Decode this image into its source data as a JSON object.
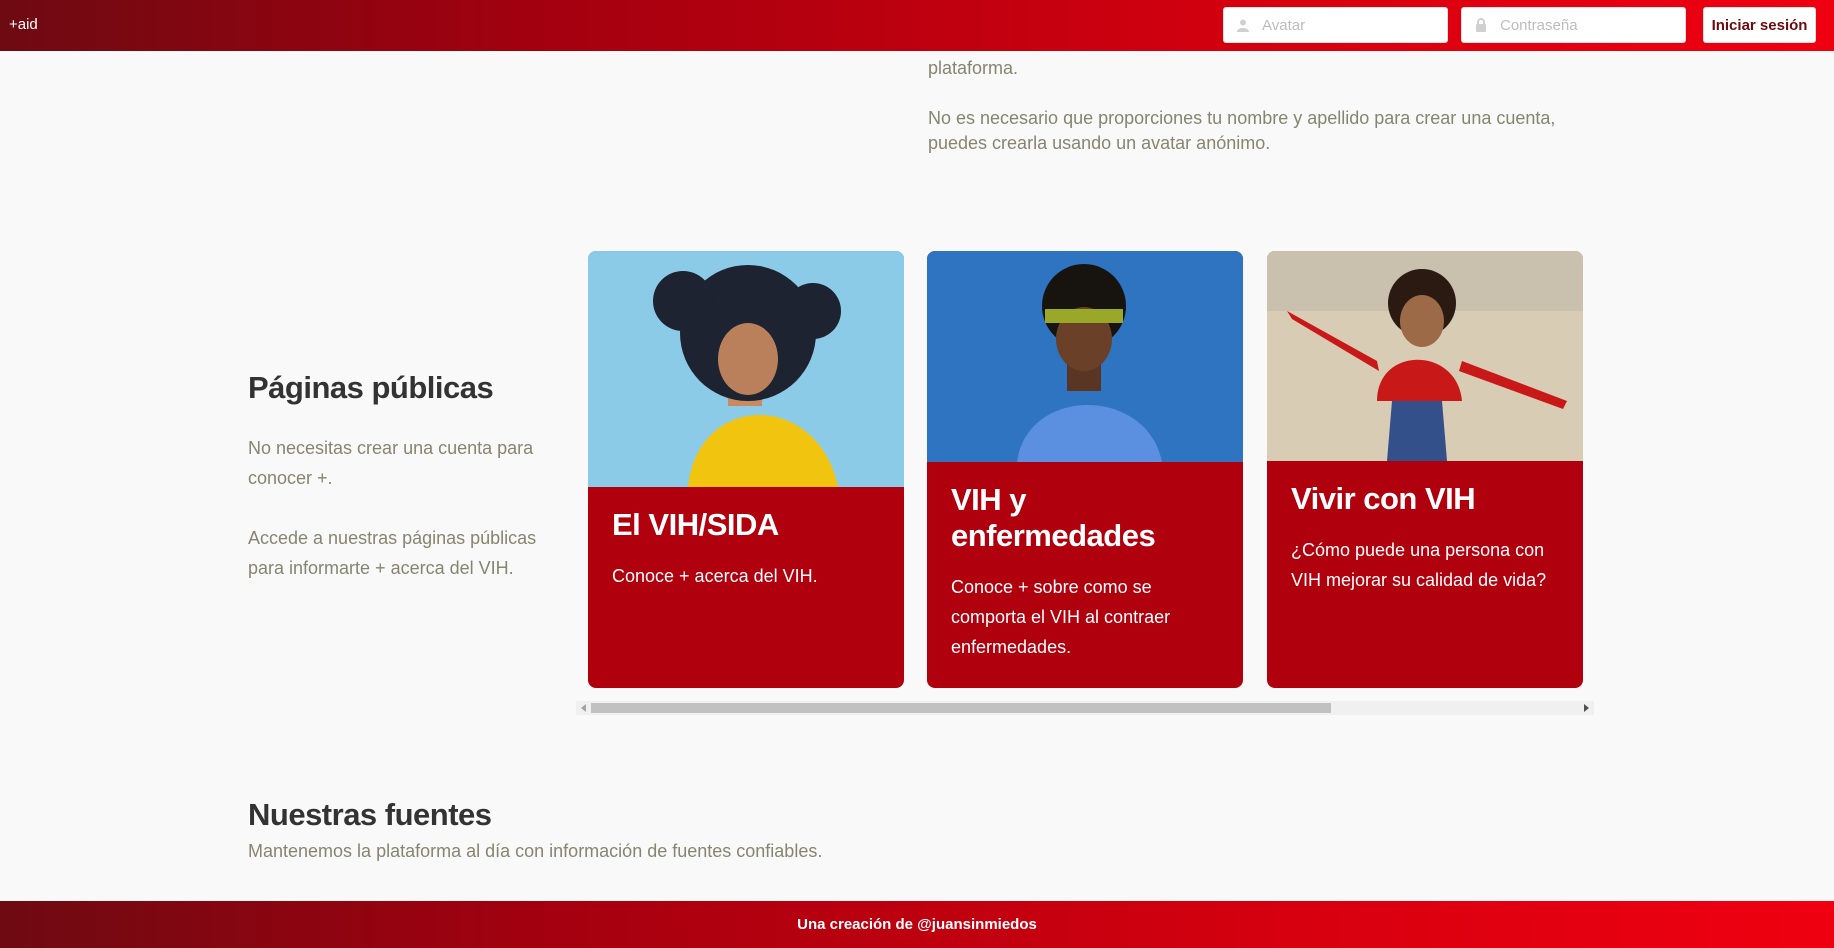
{
  "header": {
    "brand": "+aid",
    "avatar_placeholder": "Avatar",
    "password_placeholder": "Contraseña",
    "login_label": "Iniciar sesión"
  },
  "intro": {
    "line1": "plataforma.",
    "line2": "No es necesario que proporciones tu nombre y apellido para crear una cuenta, puedes crearla usando un avatar anónimo."
  },
  "public_pages": {
    "title": "Páginas públicas",
    "text1": "No necesitas crear una cuenta para conocer +.",
    "text2": "Accede a nuestras páginas públicas para informarte + acerca del VIH.",
    "cards": [
      {
        "title": "El VIH/SIDA",
        "text": "Conoce + acerca del VIH."
      },
      {
        "title": "VIH y enfermedades",
        "text": "Conoce + sobre como se comporta el VIH al contraer enfermedades."
      },
      {
        "title": "Vivir con VIH",
        "text": "¿Cómo puede una persona con VIH mejorar su calidad de vida?"
      }
    ]
  },
  "sources": {
    "title": "Nuestras fuentes",
    "text": "Mantenemos la plataforma al día con información de fuentes confiables."
  },
  "footer": {
    "text": "Una creación de @juansinmiedos"
  },
  "colors": {
    "brand_red": "#b0000d",
    "header_dark": "#6e0a12",
    "header_bright": "#ef0010"
  }
}
